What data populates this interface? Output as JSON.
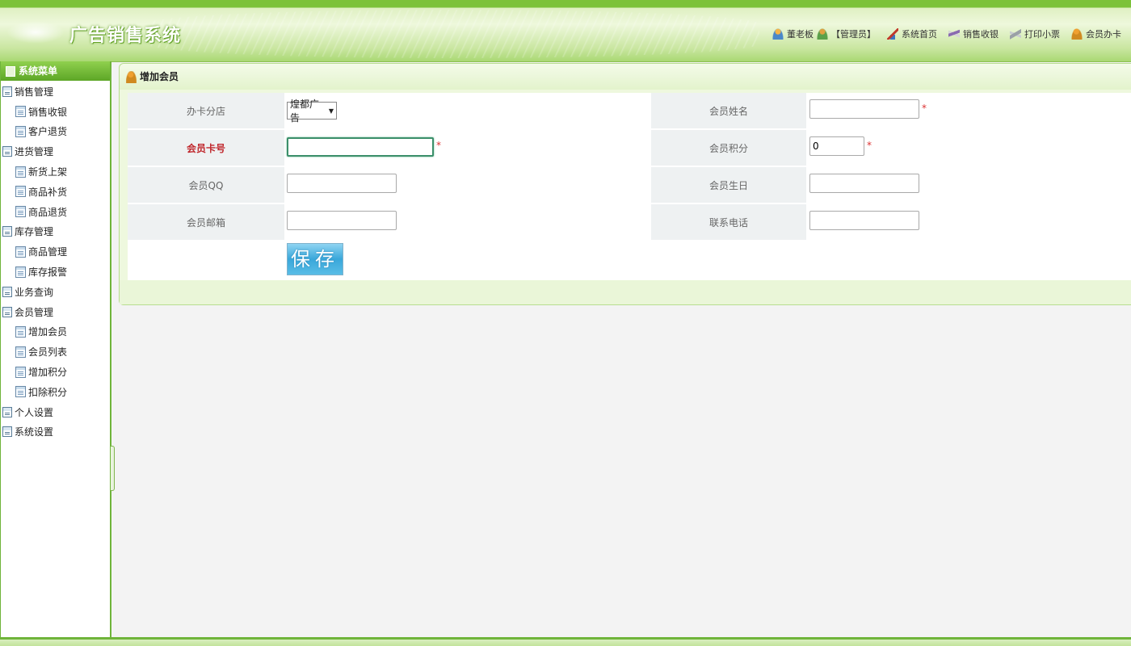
{
  "header": {
    "app_title": "广告销售系统",
    "nav": [
      {
        "label": "董老板",
        "icon": "user-icon"
      },
      {
        "label": "【管理员】",
        "icon": "role-icon"
      },
      {
        "label": "系统首页",
        "icon": "home-icon"
      },
      {
        "label": "销售收银",
        "icon": "cashier-icon"
      },
      {
        "label": "打印小票",
        "icon": "print-icon"
      },
      {
        "label": "会员办卡",
        "icon": "member-card-icon"
      }
    ]
  },
  "sidebar": {
    "title": "系统菜单",
    "groups": [
      {
        "label": "销售管理",
        "children": [
          "销售收银",
          "客户退货"
        ]
      },
      {
        "label": "进货管理",
        "children": [
          "新货上架",
          "商品补货",
          "商品退货"
        ]
      },
      {
        "label": "库存管理",
        "children": [
          "商品管理",
          "库存报警"
        ]
      },
      {
        "label": "业务查询",
        "children": []
      },
      {
        "label": "会员管理",
        "children": [
          "增加会员",
          "会员列表",
          "增加积分",
          "扣除积分"
        ]
      },
      {
        "label": "个人设置",
        "children": []
      },
      {
        "label": "系统设置",
        "children": []
      }
    ]
  },
  "panel": {
    "title": "增加会员"
  },
  "form": {
    "branch_label": "办卡分店",
    "branch_value": "煌都广告",
    "card_no_label": "会员卡号",
    "card_no_value": "",
    "qq_label": "会员QQ",
    "qq_value": "",
    "email_label": "会员邮箱",
    "email_value": "",
    "name_label": "会员姓名",
    "name_value": "",
    "points_label": "会员积分",
    "points_value": "0",
    "birthday_label": "会员生日",
    "birthday_value": "",
    "phone_label": "联系电话",
    "phone_value": "",
    "required_mark": "*",
    "save_label": "保存"
  },
  "colors": {
    "brand_green": "#7cc23a",
    "required_red": "#c0282d",
    "save_blue": "#3aa7da"
  }
}
